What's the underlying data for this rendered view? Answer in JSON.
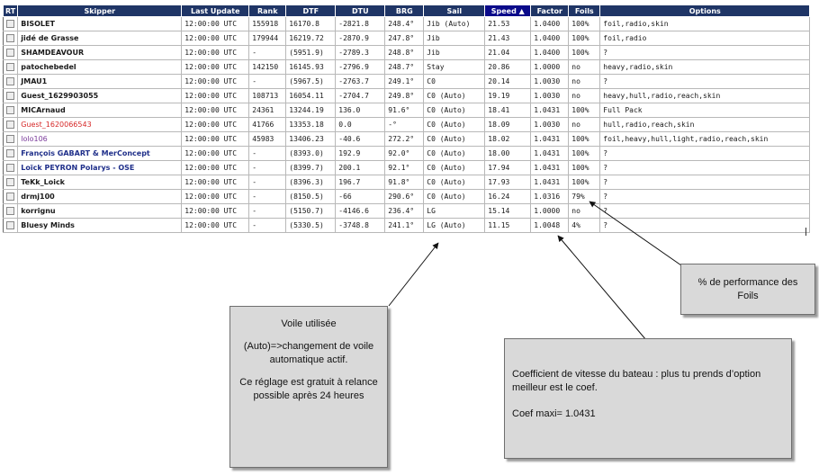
{
  "table": {
    "headers": [
      "RT",
      "Skipper",
      "Last Update",
      "Rank",
      "DTF",
      "DTU",
      "BRG",
      "Sail",
      "Speed ▲",
      "Factor",
      "Foils",
      "Options"
    ],
    "rows": [
      {
        "skipper": "BISOLET",
        "style": "",
        "last_update": "12:00:00 UTC",
        "rank": "155918",
        "dtf": "16170.8",
        "dtu": "-2821.8",
        "brg": "248.4°",
        "sail": "Jib (Auto)",
        "speed": "21.53",
        "factor": "1.0400",
        "foils": "100%",
        "options": "foil,radio,skin"
      },
      {
        "skipper": "jidé de Grasse",
        "style": "",
        "last_update": "12:00:00 UTC",
        "rank": "179944",
        "dtf": "16219.72",
        "dtu": "-2870.9",
        "brg": "247.8°",
        "sail": "Jib",
        "speed": "21.43",
        "factor": "1.0400",
        "foils": "100%",
        "options": "foil,radio"
      },
      {
        "skipper": "SHAMDEAVOUR",
        "style": "",
        "last_update": "12:00:00 UTC",
        "rank": "-",
        "dtf": "(5951.9)",
        "dtu": "-2789.3",
        "brg": "248.8°",
        "sail": "Jib",
        "speed": "21.04",
        "factor": "1.0400",
        "foils": "100%",
        "options": "?"
      },
      {
        "skipper": "patochebedel",
        "style": "",
        "last_update": "12:00:00 UTC",
        "rank": "142150",
        "dtf": "16145.93",
        "dtu": "-2796.9",
        "brg": "248.7°",
        "sail": "Stay",
        "speed": "20.86",
        "factor": "1.0000",
        "foils": "no",
        "options": "heavy,radio,skin"
      },
      {
        "skipper": "JMAU1",
        "style": "",
        "last_update": "12:00:00 UTC",
        "rank": "-",
        "dtf": "(5967.5)",
        "dtu": "-2763.7",
        "brg": "249.1°",
        "sail": "C0",
        "speed": "20.14",
        "factor": "1.0030",
        "foils": "no",
        "options": "?"
      },
      {
        "skipper": "Guest_1629903055",
        "style": "",
        "last_update": "12:00:00 UTC",
        "rank": "108713",
        "dtf": "16054.11",
        "dtu": "-2704.7",
        "brg": "249.8°",
        "sail": "C0 (Auto)",
        "speed": "19.19",
        "factor": "1.0030",
        "foils": "no",
        "options": "heavy,hull,radio,reach,skin"
      },
      {
        "skipper": "MICArnaud",
        "style": "",
        "last_update": "12:00:00 UTC",
        "rank": "24361",
        "dtf": "13244.19",
        "dtu": "136.0",
        "brg": "91.6°",
        "sail": "C0 (Auto)",
        "speed": "18.41",
        "factor": "1.0431",
        "foils": "100%",
        "options": "Full Pack"
      },
      {
        "skipper": "Guest_1620066543",
        "style": "red",
        "last_update": "12:00:00 UTC",
        "rank": "41766",
        "dtf": "13353.18",
        "dtu": "0.0",
        "brg": "-°",
        "sail": "C0 (Auto)",
        "speed": "18.09",
        "factor": "1.0030",
        "foils": "no",
        "options": "hull,radio,reach,skin"
      },
      {
        "skipper": "lolo106",
        "style": "purple",
        "last_update": "12:00:00 UTC",
        "rank": "45983",
        "dtf": "13406.23",
        "dtu": "-40.6",
        "brg": "272.2°",
        "sail": "C0 (Auto)",
        "speed": "18.02",
        "factor": "1.0431",
        "foils": "100%",
        "options": "foil,heavy,hull,light,radio,reach,skin"
      },
      {
        "skipper": "François GABART & MerConcept",
        "style": "blue",
        "last_update": "12:00:00 UTC",
        "rank": "-",
        "dtf": "(8393.0)",
        "dtu": "192.9",
        "brg": "92.0°",
        "sail": "C0 (Auto)",
        "speed": "18.00",
        "factor": "1.0431",
        "foils": "100%",
        "options": "?"
      },
      {
        "skipper": "Loïck PEYRON Polarys - OSE",
        "style": "blue",
        "last_update": "12:00:00 UTC",
        "rank": "-",
        "dtf": "(8399.7)",
        "dtu": "200.1",
        "brg": "92.1°",
        "sail": "C0 (Auto)",
        "speed": "17.94",
        "factor": "1.0431",
        "foils": "100%",
        "options": "?"
      },
      {
        "skipper": "TeKk_Loick",
        "style": "",
        "last_update": "12:00:00 UTC",
        "rank": "-",
        "dtf": "(8396.3)",
        "dtu": "196.7",
        "brg": "91.8°",
        "sail": "C0 (Auto)",
        "speed": "17.93",
        "factor": "1.0431",
        "foils": "100%",
        "options": "?"
      },
      {
        "skipper": "drmj100",
        "style": "",
        "last_update": "12:00:00 UTC",
        "rank": "-",
        "dtf": "(8150.5)",
        "dtu": "-66",
        "brg": "290.6°",
        "sail": "C0 (Auto)",
        "speed": "16.24",
        "factor": "1.0316",
        "foils": "79%",
        "options": "?"
      },
      {
        "skipper": "korrignu",
        "style": "",
        "last_update": "12:00:00 UTC",
        "rank": "-",
        "dtf": "(5150.7)",
        "dtu": "-4146.6",
        "brg": "236.4°",
        "sail": "LG",
        "speed": "15.14",
        "factor": "1.0000",
        "foils": "no",
        "options": "?"
      },
      {
        "skipper": "Bluesy Minds",
        "style": "",
        "last_update": "12:00:00 UTC",
        "rank": "-",
        "dtf": "(5330.5)",
        "dtu": "-3748.8",
        "brg": "241.1°",
        "sail": "LG (Auto)",
        "speed": "11.15",
        "factor": "1.0048",
        "foils": "4%",
        "options": "?"
      }
    ]
  },
  "callouts": {
    "sail": {
      "line1": "Voile utilisée",
      "line2": "(Auto)=>changement de voile automatique actif.",
      "line3": "Ce réglage est gratuit à relance possible après 24 heures"
    },
    "coef": {
      "line1": "Coefficient de vitesse du bateau : plus tu prends d’option meilleur est le coef.",
      "line2": "Coef maxi= 1.0431"
    },
    "foils": {
      "line1": "% de performance des Foils"
    }
  },
  "colors": {
    "header_bg": "#1f3566",
    "sorted_header_bg": "#0a0a8a",
    "callout_bg": "#d9d9d9",
    "red_skipper": "#d62828",
    "purple_skipper": "#7a3a9a",
    "blue_skipper": "#1f2f8a"
  }
}
